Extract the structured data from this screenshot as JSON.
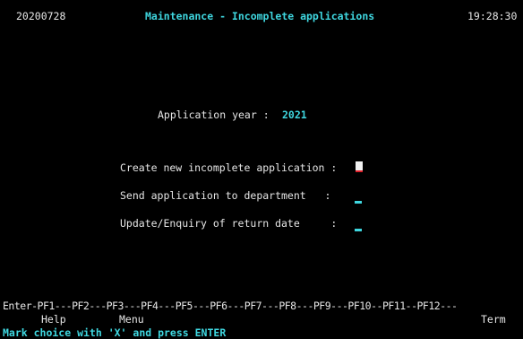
{
  "header": {
    "date": "20200728",
    "title": "Maintenance - Incomplete applications",
    "time": "19:28:30"
  },
  "application_year": {
    "label": "Application year :",
    "value": "2021"
  },
  "options": [
    {
      "label": "Create new incomplete application :",
      "choice": ""
    },
    {
      "label": "Send application to department   :",
      "choice": ""
    },
    {
      "label": "Update/Enquiry of return date     :",
      "choice": ""
    }
  ],
  "function_keys": {
    "keys_line": "Enter-PF1---PF2---PF3---PF4---PF5---PF6---PF7---PF8---PF9---PF10--PF11--PF12---",
    "pf1_label": "Help",
    "pf3_label": "Menu",
    "pf12_label": "Term"
  },
  "message": "Mark choice with 'X' and press ENTER",
  "colors": {
    "background": "#000000",
    "text": "#e6e6e6",
    "accent": "#3fd7e0",
    "cursor_underline": "#e0202a"
  }
}
